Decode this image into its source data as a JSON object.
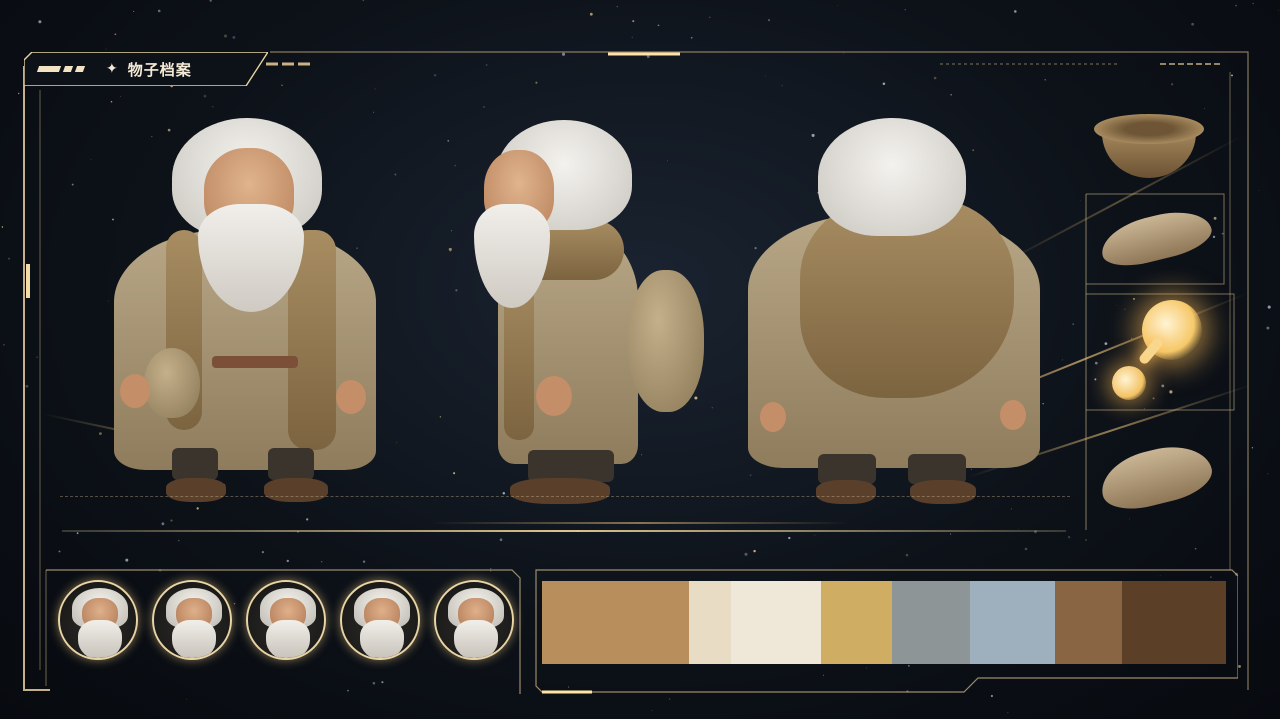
{
  "header": {
    "title": "物子档案",
    "title_icon": "sparkle-icon"
  },
  "views": [
    {
      "name": "front-view"
    },
    {
      "name": "side-view"
    },
    {
      "name": "back-view"
    }
  ],
  "props": [
    {
      "name": "wooden-bowl"
    },
    {
      "name": "straw-sandal"
    },
    {
      "name": "glowing-gourd"
    },
    {
      "name": "straw-shoe"
    }
  ],
  "expressions": {
    "count": 5
  },
  "palette": {
    "colors": [
      "#b88f5c",
      "#e8dcc4",
      "#efe7d8",
      "#cfae63",
      "#8e9597",
      "#9eb0bd",
      "#8a6543",
      "#5b3f27"
    ],
    "weights": [
      1.5,
      0.42,
      0.92,
      0.72,
      0.8,
      0.86,
      0.68,
      1.06
    ]
  },
  "theme": {
    "accent": "#e9cf98",
    "background": "#0d1219"
  }
}
